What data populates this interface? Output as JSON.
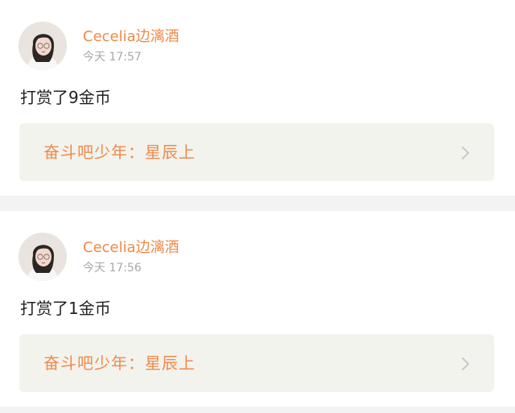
{
  "colors": {
    "accent": "#ef8a4a",
    "link_bg": "#f3f3ee",
    "separator": "#f3f3f3",
    "time_gray": "#a8a8a8"
  },
  "feed": [
    {
      "username": "Cecelia边漓酒",
      "time": "今天 17:57",
      "message": "打赏了9金币",
      "link_text": "奋斗吧少年：星辰上",
      "link_icon": "chevron-right-icon",
      "avatar_icon": "user-avatar"
    },
    {
      "username": "Cecelia边漓酒",
      "time": "今天 17:56",
      "message": "打赏了1金币",
      "link_text": "奋斗吧少年：星辰上",
      "link_icon": "chevron-right-icon",
      "avatar_icon": "user-avatar"
    }
  ]
}
